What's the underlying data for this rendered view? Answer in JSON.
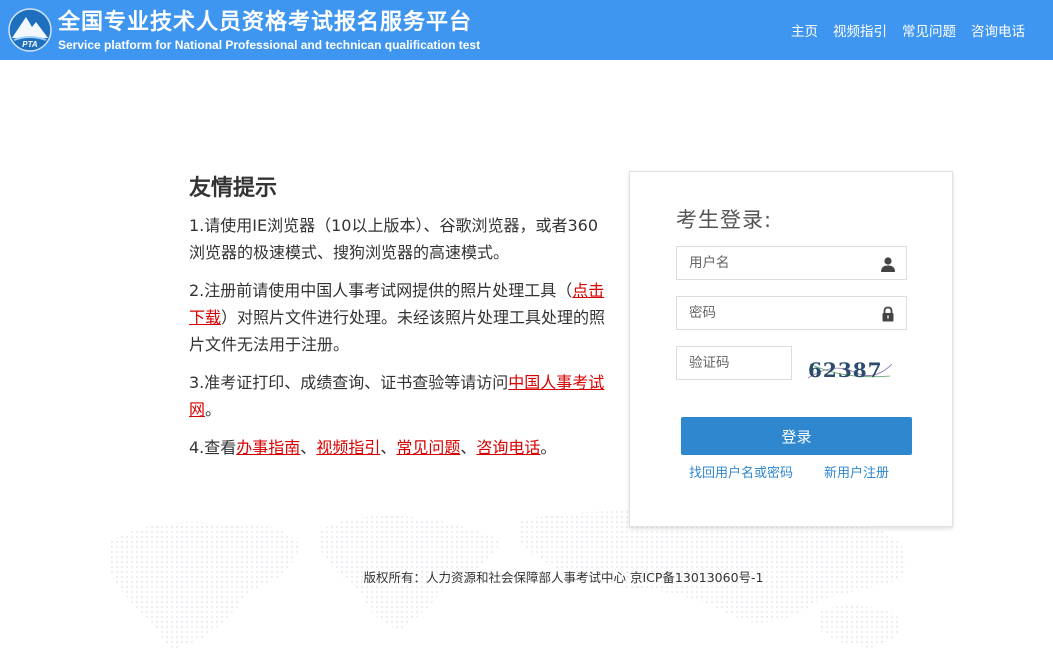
{
  "header": {
    "logo_text": "PTA",
    "title": "全国专业技术人员资格考试报名服务平台",
    "subtitle": "Service platform for National Professional and technican qualification test",
    "nav": [
      "主页",
      "视频指引",
      "常见问题",
      "咨询电话"
    ]
  },
  "tips": {
    "title": "友情提示",
    "item1": "1.请使用IE浏览器（10以上版本）、谷歌浏览器，或者360浏览器的极速模式、搜狗浏览器的高速模式。",
    "item2_before": "2.注册前请使用中国人事考试网提供的照片处理工具（",
    "item2_link": "点击下载",
    "item2_after": "）对照片文件进行处理。未经该照片处理工具处理的照片文件无法用于注册。",
    "item3_before": "3.准考证打印、成绩查询、证书查验等请访问",
    "item3_link": "中国人事考试网",
    "item3_after": "。",
    "item4_before": "4.查看",
    "item4_links": [
      "办事指南",
      "视频指引",
      "常见问题",
      "咨询电话"
    ],
    "item4_sep": "、",
    "item4_after": "。"
  },
  "login": {
    "title": "考生登录:",
    "username_placeholder": "用户名",
    "password_placeholder": "密码",
    "captcha_placeholder": "验证码",
    "captcha_code": "62387",
    "submit_label": "登录",
    "forgot_link": "找回用户名或密码",
    "register_link": "新用户注册"
  },
  "footer": {
    "copyright": "版权所有：人力资源和社会保障部人事考试中心 京ICP备13013060号-1"
  },
  "colors": {
    "header_bg": "#3f96f0",
    "accent": "#2f87cf",
    "link_red": "#d80000"
  }
}
